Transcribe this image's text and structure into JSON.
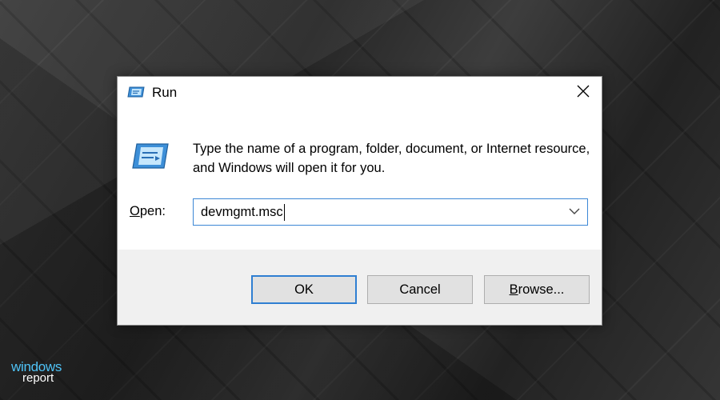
{
  "dialog": {
    "title": "Run",
    "title_icon": "run-app-icon",
    "close_icon": "close-icon",
    "main_icon": "run-program-icon",
    "description": "Type the name of a program, folder, document, or Internet resource, and Windows will open it for you.",
    "open_label_accel": "O",
    "open_label_rest": "pen:",
    "open_value": "devmgmt.msc",
    "dropdown_icon": "chevron-down-icon",
    "buttons": {
      "ok": "OK",
      "cancel": "Cancel",
      "browse_accel": "B",
      "browse_rest": "rowse..."
    }
  },
  "brand": {
    "line1": "windows",
    "line2": "report"
  },
  "colors": {
    "accent": "#2f7fd2",
    "dialog_bg": "#ffffff",
    "footer_bg": "#f0f0f0",
    "brand_blue": "#4fc3f7"
  }
}
